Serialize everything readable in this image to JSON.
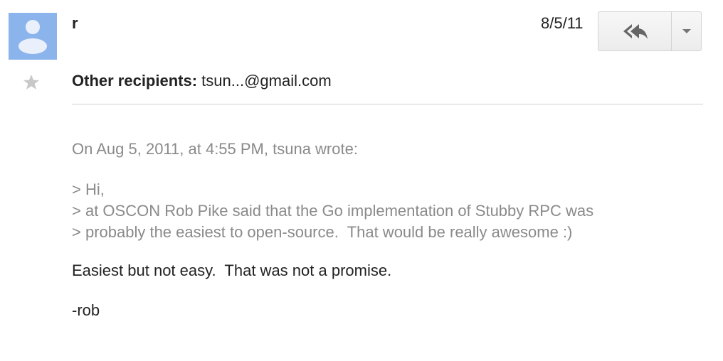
{
  "message": {
    "sender": "r",
    "date": "8/5/11",
    "recipients_label": "Other recipients:",
    "recipients_value": "tsun...@gmail.com",
    "quote_header": "On Aug 5, 2011, at 4:55 PM, tsuna wrote:",
    "quoted_lines": [
      "> Hi,",
      "> at OSCON Rob Pike said that the Go implementation of Stubby RPC was",
      "> probably the easiest to open-source.  That would be really awesome :)"
    ],
    "reply": "Easiest but not easy.  That was not a promise.",
    "signature": "-rob"
  },
  "icons": {
    "avatar": "default-avatar-icon",
    "star": "star-icon",
    "reply_all": "reply-all-icon",
    "more": "chevron-down-icon"
  },
  "colors": {
    "avatar_bg": "#8cb4ec",
    "quoted_text": "#8a8a8a",
    "body_text": "#222222"
  }
}
